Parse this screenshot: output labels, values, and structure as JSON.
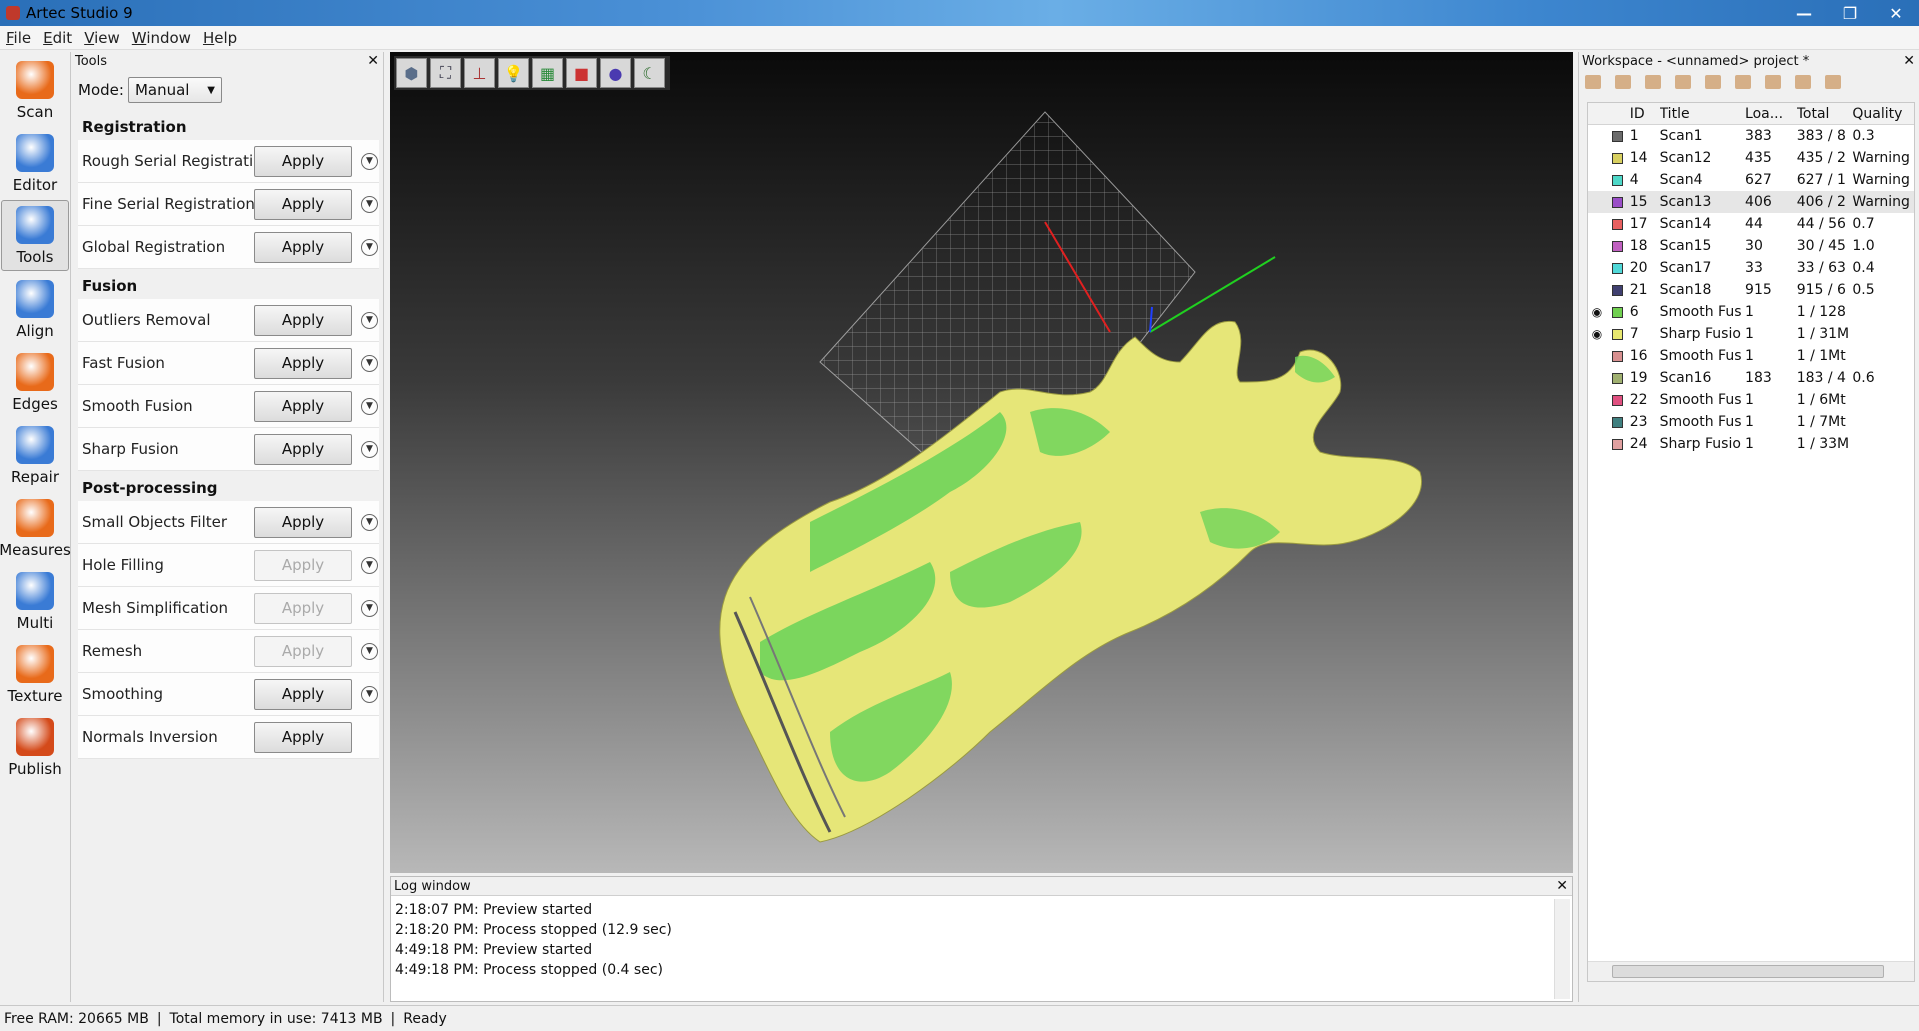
{
  "window": {
    "title": "Artec Studio 9"
  },
  "menu": [
    "File",
    "Edit",
    "View",
    "Window",
    "Help"
  ],
  "iconbar": [
    {
      "label": "Scan",
      "icon": "scan-icon",
      "color": "#e86a1a"
    },
    {
      "label": "Editor",
      "icon": "editor-icon",
      "color": "#3a7bd5"
    },
    {
      "label": "Tools",
      "icon": "tools-icon",
      "color": "#3a7bd5",
      "active": true
    },
    {
      "label": "Align",
      "icon": "align-icon",
      "color": "#3a7bd5"
    },
    {
      "label": "Edges",
      "icon": "edges-icon",
      "color": "#e86a1a"
    },
    {
      "label": "Repair",
      "icon": "repair-icon",
      "color": "#3a7bd5"
    },
    {
      "label": "Measures",
      "icon": "measures-icon",
      "color": "#e86a1a"
    },
    {
      "label": "Multi",
      "icon": "multi-icon",
      "color": "#3a7bd5"
    },
    {
      "label": "Texture",
      "icon": "texture-icon",
      "color": "#e86a1a"
    },
    {
      "label": "Publish",
      "icon": "publish-icon",
      "color": "#d44a1a"
    }
  ],
  "tools": {
    "header": "Tools",
    "mode_label": "Mode:",
    "mode_value": "Manual",
    "sections": [
      {
        "title": "Registration",
        "items": [
          {
            "name": "Rough Serial Registration",
            "apply": "Apply",
            "enabled": true,
            "expand": true
          },
          {
            "name": "Fine Serial Registration",
            "apply": "Apply",
            "enabled": true,
            "expand": true
          },
          {
            "name": "Global Registration",
            "apply": "Apply",
            "enabled": true,
            "expand": true
          }
        ]
      },
      {
        "title": "Fusion",
        "items": [
          {
            "name": "Outliers Removal",
            "apply": "Apply",
            "enabled": true,
            "expand": true
          },
          {
            "name": "Fast Fusion",
            "apply": "Apply",
            "enabled": true,
            "expand": true
          },
          {
            "name": "Smooth Fusion",
            "apply": "Apply",
            "enabled": true,
            "expand": true
          },
          {
            "name": "Sharp Fusion",
            "apply": "Apply",
            "enabled": true,
            "expand": true
          }
        ]
      },
      {
        "title": "Post-processing",
        "items": [
          {
            "name": "Small Objects Filter",
            "apply": "Apply",
            "enabled": true,
            "expand": true
          },
          {
            "name": "Hole Filling",
            "apply": "Apply",
            "enabled": false,
            "expand": true
          },
          {
            "name": "Mesh Simplification",
            "apply": "Apply",
            "enabled": false,
            "expand": true
          },
          {
            "name": "Remesh",
            "apply": "Apply",
            "enabled": false,
            "expand": true
          },
          {
            "name": "Smoothing",
            "apply": "Apply",
            "enabled": true,
            "expand": true
          },
          {
            "name": "Normals Inversion",
            "apply": "Apply",
            "enabled": true,
            "expand": false
          }
        ]
      }
    ]
  },
  "viewport": {
    "toolbar_icons": [
      "cube-view-icon",
      "fit-view-icon",
      "axes-icon",
      "light-icon",
      "texture-view-icon",
      "shaded-view-icon",
      "sphere-view-icon",
      "moon-view-icon"
    ],
    "model_colors": {
      "yellow": "#e6e678",
      "green": "#6fd45a"
    }
  },
  "log": {
    "header": "Log window",
    "lines": [
      "2:18:07 PM: Preview started",
      "2:18:20 PM: Process stopped (12.9 sec)",
      "4:49:18 PM: Preview started",
      "4:49:18 PM: Process stopped (0.4 sec)"
    ]
  },
  "workspace": {
    "header": "Workspace - <unnamed> project *",
    "columns": [
      "ID",
      "Title",
      "Loa...",
      "Total",
      "Quality"
    ],
    "rows": [
      {
        "eye": "",
        "color": "#6b6b6b",
        "id": "1",
        "title": "Scan1",
        "load": "383",
        "total": "383 / 8",
        "quality": "0.3"
      },
      {
        "eye": "",
        "color": "#d8d060",
        "id": "14",
        "title": "Scan12",
        "load": "435",
        "total": "435 / 2",
        "quality": "Warning"
      },
      {
        "eye": "",
        "color": "#4ed8c8",
        "id": "4",
        "title": "Scan4",
        "load": "627",
        "total": "627 / 1",
        "quality": "Warning"
      },
      {
        "eye": "",
        "color": "#9a4ec8",
        "id": "15",
        "title": "Scan13",
        "load": "406",
        "total": "406 / 2",
        "quality": "Warning",
        "selected": true
      },
      {
        "eye": "",
        "color": "#e86060",
        "id": "17",
        "title": "Scan14",
        "load": "44",
        "total": "44 / 56",
        "quality": "0.7"
      },
      {
        "eye": "",
        "color": "#c060c0",
        "id": "18",
        "title": "Scan15",
        "load": "30",
        "total": "30 / 45",
        "quality": "1.0"
      },
      {
        "eye": "",
        "color": "#50d8d8",
        "id": "20",
        "title": "Scan17",
        "load": "33",
        "total": "33 / 63",
        "quality": "0.4"
      },
      {
        "eye": "",
        "color": "#404070",
        "id": "21",
        "title": "Scan18",
        "load": "915",
        "total": "915 / 6",
        "quality": "0.5"
      },
      {
        "eye": "◉",
        "color": "#70d050",
        "id": "6",
        "title": "Smooth Fus",
        "load": "1",
        "total": "1 / 128",
        "quality": ""
      },
      {
        "eye": "◉",
        "color": "#e8e870",
        "id": "7",
        "title": "Sharp Fusio",
        "load": "1",
        "total": "1 / 31M",
        "quality": ""
      },
      {
        "eye": "",
        "color": "#d89090",
        "id": "16",
        "title": "Smooth Fus",
        "load": "1",
        "total": "1 / 1Mt",
        "quality": ""
      },
      {
        "eye": "",
        "color": "#a0b070",
        "id": "19",
        "title": "Scan16",
        "load": "183",
        "total": "183 / 4",
        "quality": "0.6"
      },
      {
        "eye": "",
        "color": "#e05080",
        "id": "22",
        "title": "Smooth Fus",
        "load": "1",
        "total": "1 / 6Mt",
        "quality": ""
      },
      {
        "eye": "",
        "color": "#408080",
        "id": "23",
        "title": "Smooth Fus",
        "load": "1",
        "total": "1 / 7Mt",
        "quality": ""
      },
      {
        "eye": "",
        "color": "#e0a0a0",
        "id": "24",
        "title": "Sharp Fusio",
        "load": "1",
        "total": "1 / 33M",
        "quality": ""
      }
    ]
  },
  "status": {
    "free_ram": "Free RAM: 20665 MB",
    "total_memory": "Total memory in use: 7413 MB",
    "state": "Ready"
  }
}
